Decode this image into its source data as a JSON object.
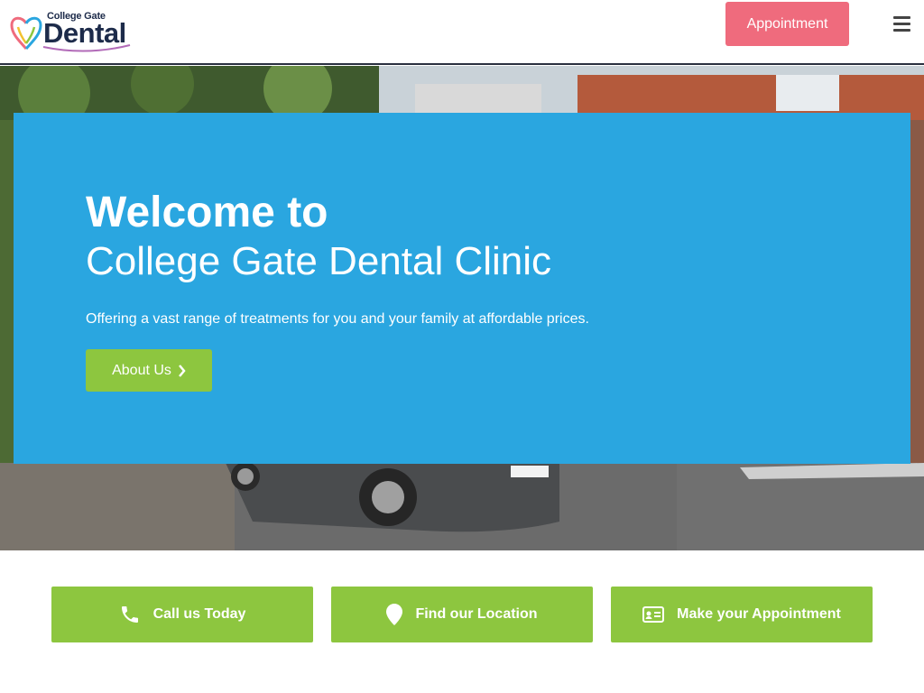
{
  "header": {
    "logo_small": "College Gate",
    "logo_big": "Dental",
    "appointment_label": "Appointment"
  },
  "hero": {
    "title": "Welcome to",
    "subtitle": "College Gate Dental Clinic",
    "text": "Offering a vast range of treatments for you and your family at affordable prices.",
    "about_label": "About Us"
  },
  "cta": [
    {
      "label": "Call us Today",
      "icon": "phone-icon"
    },
    {
      "label": "Find our Location",
      "icon": "map-pin-icon"
    },
    {
      "label": "Make your Appointment",
      "icon": "id-card-icon"
    }
  ],
  "colors": {
    "accent_pink": "#ef6b7d",
    "panel_blue": "#2aa6e0",
    "button_green": "#8dc63f",
    "logo_navy": "#1d2b4a"
  }
}
